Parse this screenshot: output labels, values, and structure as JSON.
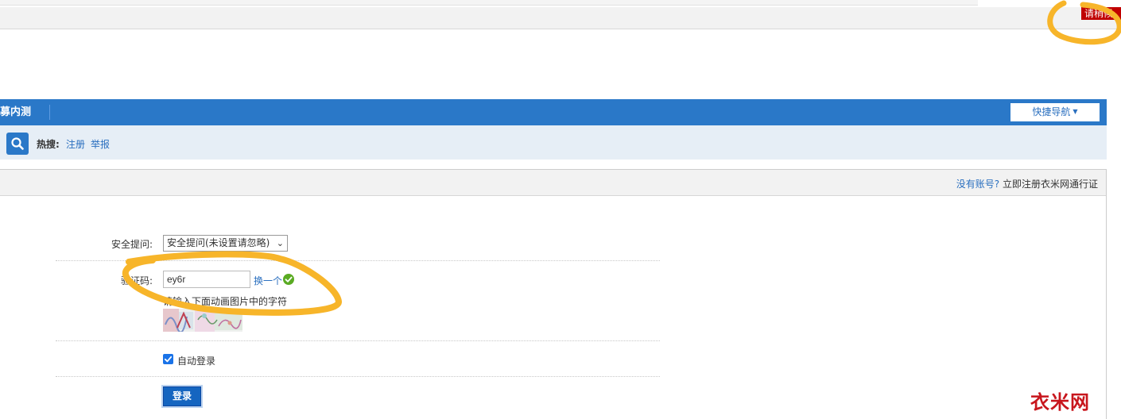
{
  "header": {
    "wait_badge": "请稍候"
  },
  "nav": {
    "title": "招募内测",
    "quick_nav": "快捷导航"
  },
  "search": {
    "hot_label": "热搜:",
    "hot_links": [
      "注册",
      "举报"
    ]
  },
  "panel": {
    "no_account_q": "没有账号?",
    "register_link": "立即注册衣米网通行证"
  },
  "form": {
    "security_label": "安全提问:",
    "security_selected": "安全提问(未设置请忽略)",
    "captcha_label": "验证码:",
    "captcha_value": "ey6r",
    "change_link": "换一个",
    "captcha_hint": "请输入下面动画图片中的字符",
    "auto_login_label": "自动登录",
    "auto_login_checked": true,
    "login_button": "登录"
  },
  "watermark": "衣米网",
  "colors": {
    "nav_blue": "#2a78c8",
    "badge_red": "#c00000",
    "annotation_orange": "#f7b52a",
    "watermark_red": "#c8161d"
  }
}
